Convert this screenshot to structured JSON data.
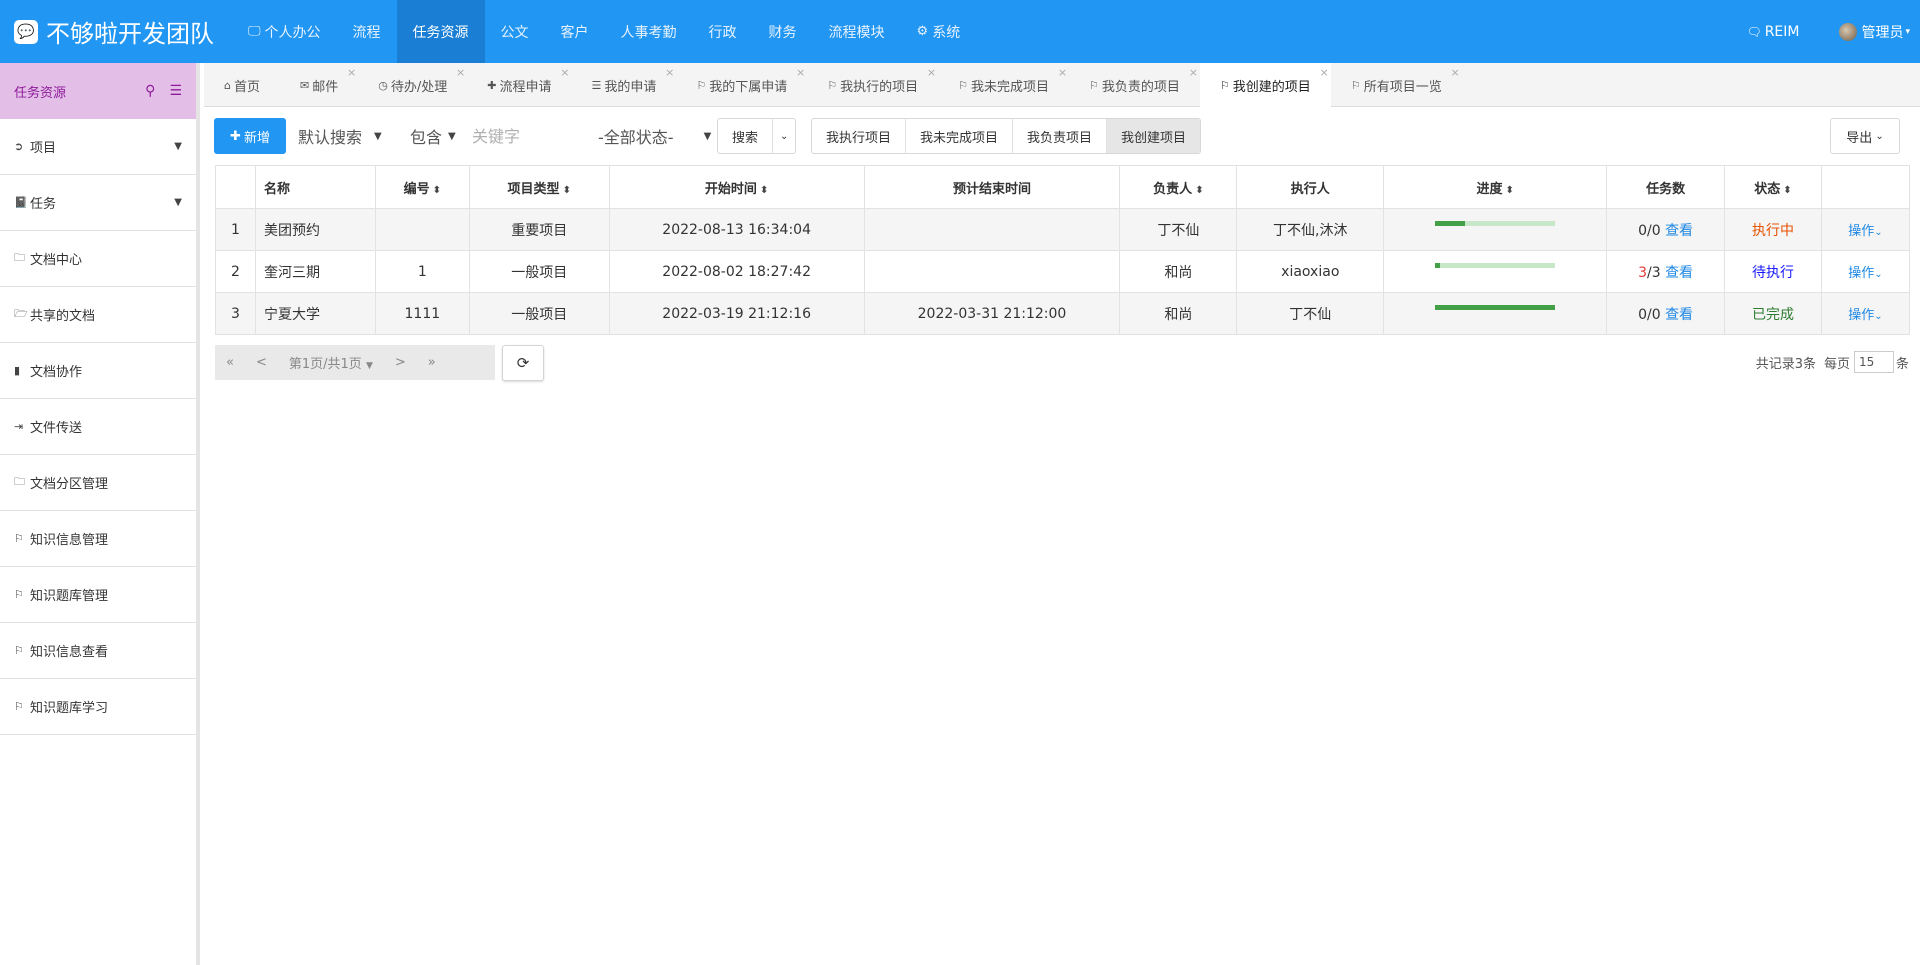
{
  "app": {
    "brand": "不够啦开发团队",
    "brand_logo": "💬"
  },
  "topnav": [
    {
      "label": "个人办公",
      "icon": "monitor-icon",
      "glyph": "🖵",
      "active": false
    },
    {
      "label": "流程",
      "icon": "",
      "glyph": "",
      "active": false
    },
    {
      "label": "任务资源",
      "icon": "",
      "glyph": "",
      "active": true
    },
    {
      "label": "公文",
      "icon": "",
      "glyph": "",
      "active": false
    },
    {
      "label": "客户",
      "icon": "",
      "glyph": "",
      "active": false
    },
    {
      "label": "人事考勤",
      "icon": "",
      "glyph": "",
      "active": false
    },
    {
      "label": "行政",
      "icon": "",
      "glyph": "",
      "active": false
    },
    {
      "label": "财务",
      "icon": "",
      "glyph": "",
      "active": false
    },
    {
      "label": "流程模块",
      "icon": "",
      "glyph": "",
      "active": false
    },
    {
      "label": "系统",
      "icon": "gear-icon",
      "glyph": "⚙",
      "active": false
    }
  ],
  "topright": {
    "reim": "REIM",
    "user": "管理员"
  },
  "sidebar": {
    "title": "任务资源",
    "items": [
      {
        "label": "项目",
        "icon": "circle-arrow-icon",
        "glyph": "➲",
        "caret": true
      },
      {
        "label": "任务",
        "icon": "book-icon",
        "glyph": "📓",
        "caret": true
      },
      {
        "label": "文档中心",
        "icon": "folder-icon",
        "glyph": "🗀",
        "caret": false
      },
      {
        "label": "共享的文档",
        "icon": "folder-open-icon",
        "glyph": "🗁",
        "caret": false
      },
      {
        "label": "文档协作",
        "icon": "file-icon",
        "glyph": "▮",
        "caret": false
      },
      {
        "label": "文件传送",
        "icon": "sign-out-icon",
        "glyph": "⇥",
        "caret": false
      },
      {
        "label": "文档分区管理",
        "icon": "folder-icon",
        "glyph": "🗀",
        "caret": false
      },
      {
        "label": "知识信息管理",
        "icon": "bookmark-icon",
        "glyph": "⚐",
        "caret": false
      },
      {
        "label": "知识题库管理",
        "icon": "bookmark-icon",
        "glyph": "⚐",
        "caret": false
      },
      {
        "label": "知识信息查看",
        "icon": "bookmark-icon",
        "glyph": "⚐",
        "caret": false
      },
      {
        "label": "知识题库学习",
        "icon": "bookmark-icon",
        "glyph": "⚐",
        "caret": false
      }
    ]
  },
  "tabs": [
    {
      "label": "首页",
      "icon": "home-icon",
      "glyph": "⌂",
      "closable": false,
      "active": false
    },
    {
      "label": "邮件",
      "icon": "envelope-icon",
      "glyph": "✉",
      "closable": true,
      "active": false
    },
    {
      "label": "待办/处理",
      "icon": "clock-icon",
      "glyph": "◷",
      "closable": true,
      "active": false
    },
    {
      "label": "流程申请",
      "icon": "plus-icon",
      "glyph": "✚",
      "closable": true,
      "active": false
    },
    {
      "label": "我的申请",
      "icon": "list-icon",
      "glyph": "☰",
      "closable": true,
      "active": false
    },
    {
      "label": "我的下属申请",
      "icon": "bookmark-icon",
      "glyph": "⚐",
      "closable": true,
      "active": false
    },
    {
      "label": "我执行的项目",
      "icon": "bookmark-icon",
      "glyph": "⚐",
      "closable": true,
      "active": false
    },
    {
      "label": "我未完成项目",
      "icon": "bookmark-icon",
      "glyph": "⚐",
      "closable": true,
      "active": false
    },
    {
      "label": "我负责的项目",
      "icon": "bookmark-icon",
      "glyph": "⚐",
      "closable": true,
      "active": false
    },
    {
      "label": "我创建的项目",
      "icon": "bookmark-icon",
      "glyph": "⚐",
      "closable": true,
      "active": true
    },
    {
      "label": "所有项目一览",
      "icon": "bookmark-icon",
      "glyph": "⚐",
      "closable": true,
      "active": false
    }
  ],
  "toolbar": {
    "new_label": "新增",
    "search_mode": "默认搜索",
    "match": "包含",
    "keyword_placeholder": "关键字",
    "status": "-全部状态-",
    "search_label": "搜索",
    "filters": [
      {
        "label": "我执行项目",
        "active": false
      },
      {
        "label": "我未完成项目",
        "active": false
      },
      {
        "label": "我负责项目",
        "active": false
      },
      {
        "label": "我创建项目",
        "active": true
      }
    ],
    "export_label": "导出"
  },
  "table": {
    "headers": {
      "name": "名称",
      "num": "编号",
      "type": "项目类型",
      "start": "开始时间",
      "end": "预计结束时间",
      "owner": "负责人",
      "executor": "执行人",
      "progress": "进度",
      "tasks": "任务数",
      "status": "状态"
    },
    "rows": [
      {
        "idx": "1",
        "name": "美团预约",
        "num": "",
        "type": "重要项目",
        "start": "2022-08-13 16:34:04",
        "end": "",
        "owner": "丁不仙",
        "executor": "丁不仙,沐沐",
        "progress": 0.25,
        "tasks_done": "0",
        "tasks_total": "/0",
        "tasks_done_red": false,
        "view": "查看",
        "status": "执行中",
        "status_class": "st-running",
        "op": "操作"
      },
      {
        "idx": "2",
        "name": "奎河三期",
        "num": "1",
        "type": "一般项目",
        "start": "2022-08-02 18:27:42",
        "end": "",
        "owner": "和尚",
        "executor": "xiaoxiao",
        "progress": 0.04,
        "tasks_done": "3",
        "tasks_total": "/3",
        "tasks_done_red": true,
        "view": "查看",
        "status": "待执行",
        "status_class": "st-waiting",
        "op": "操作"
      },
      {
        "idx": "3",
        "name": "宁夏大学",
        "num": "1111",
        "type": "一般项目",
        "start": "2022-03-19 21:12:16",
        "end": "2022-03-31 21:12:00",
        "owner": "和尚",
        "executor": "丁不仙",
        "progress": 1.0,
        "tasks_done": "0",
        "tasks_total": "/0",
        "tasks_done_red": false,
        "view": "查看",
        "status": "已完成",
        "status_class": "st-done",
        "op": "操作"
      }
    ]
  },
  "pager": {
    "first": "«",
    "prev": "<",
    "page": "第1页/共1页",
    "next": ">",
    "last": "»",
    "total": "共记录3条",
    "per_page_label": "每页",
    "per_page": "15",
    "unit": "条"
  }
}
